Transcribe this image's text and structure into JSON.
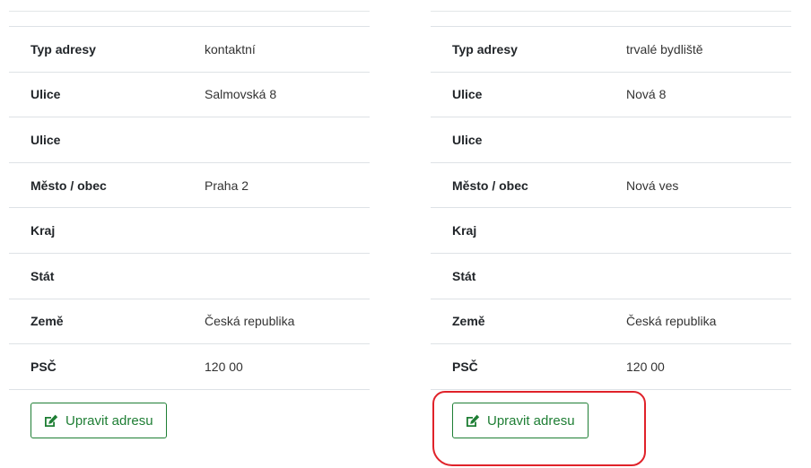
{
  "cards": [
    {
      "rows": [
        {
          "label": "Typ adresy",
          "value": "kontaktní"
        },
        {
          "label": "Ulice",
          "value": "Salmovská 8"
        },
        {
          "label": "Ulice",
          "value": ""
        },
        {
          "label": "Město / obec",
          "value": "Praha 2"
        },
        {
          "label": "Kraj",
          "value": ""
        },
        {
          "label": "Stát",
          "value": ""
        },
        {
          "label": "Země",
          "value": "Česká republika"
        },
        {
          "label": "PSČ",
          "value": "120 00"
        }
      ],
      "button_label": "Upravit adresu",
      "button_icon": "edit-icon"
    },
    {
      "rows": [
        {
          "label": "Typ adresy",
          "value": "trvalé bydliště"
        },
        {
          "label": "Ulice",
          "value": "Nová 8"
        },
        {
          "label": "Ulice",
          "value": ""
        },
        {
          "label": "Město / obec",
          "value": "Nová ves"
        },
        {
          "label": "Kraj",
          "value": ""
        },
        {
          "label": "Stát",
          "value": ""
        },
        {
          "label": "Země",
          "value": "Česká republika"
        },
        {
          "label": "PSČ",
          "value": "120 00"
        }
      ],
      "button_label": "Upravit adresu",
      "button_icon": "edit-icon"
    }
  ],
  "colors": {
    "button_green": "#1e7e34",
    "highlight_red": "#e0222a",
    "row_border": "#dee2e6"
  }
}
